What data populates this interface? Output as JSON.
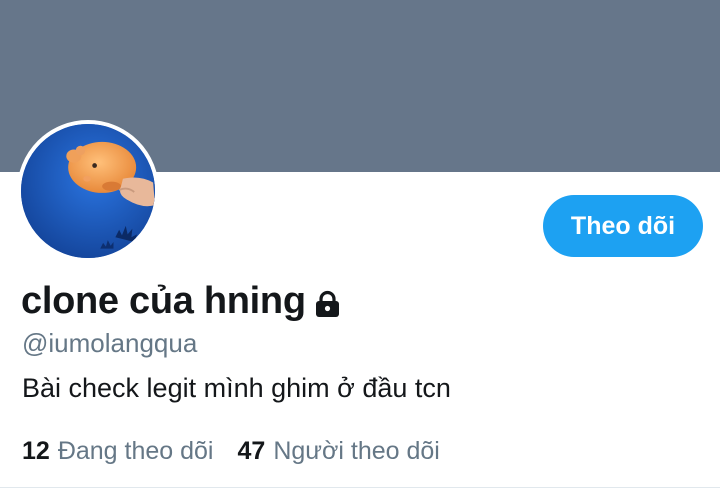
{
  "profile": {
    "display_name": "clone của hning",
    "handle": "@iumolangqua",
    "bio": "Bài check legit mình ghim ở đầu tcn",
    "protected_icon": "lock-icon",
    "banner_color": "#66768a",
    "avatar_background": "#1a56b8"
  },
  "actions": {
    "follow_label": "Theo dõi",
    "accent_color": "#1da1f2"
  },
  "stats": {
    "following_count": "12",
    "following_label": "Đang theo dõi",
    "followers_count": "47",
    "followers_label": "Người theo dõi"
  }
}
